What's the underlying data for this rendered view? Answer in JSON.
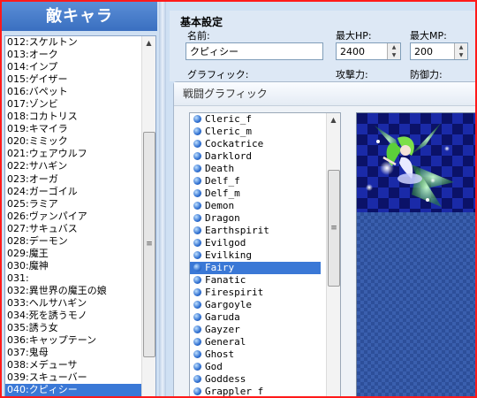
{
  "left_panel": {
    "title": "敵キャラ",
    "items": [
      "012:スケルトン",
      "013:オーク",
      "014:インプ",
      "015:ゲイザー",
      "016:バペット",
      "017:ゾンビ",
      "018:コカトリス",
      "019:キマイラ",
      "020:ミミック",
      "021:ウェアウルフ",
      "022:サハギン",
      "023:オーガ",
      "024:ガーゴイル",
      "025:ラミア",
      "026:ヴァンパイア",
      "027:サキュバス",
      "028:デーモン",
      "029:魔王",
      "030:魔神",
      "031:",
      "032:異世界の魔王の娘",
      "033:ヘルサハギン",
      "034:死を誘うモノ",
      "035:誘う女",
      "036:キャップテーン",
      "037:鬼母",
      "038:メデューサ",
      "039:スキューバー",
      "040:クピィシー"
    ],
    "selected_index": 28
  },
  "basic": {
    "title": "基本設定",
    "name_label": "名前:",
    "name_value": "クピィシー",
    "maxhp_label": "最大HP:",
    "maxhp_value": "2400",
    "maxmp_label": "最大MP:",
    "maxmp_value": "200",
    "graphic_label": "グラフィック:",
    "attack_label": "攻撃力:",
    "defense_label": "防御力:"
  },
  "dialog": {
    "title": "戦闘グラフィック",
    "items": [
      "Cleric_f",
      "Cleric_m",
      "Cockatrice",
      "Darklord",
      "Death",
      "Delf_f",
      "Delf_m",
      "Demon",
      "Dragon",
      "Earthspirit",
      "Evilgod",
      "Evilking",
      "Fairy",
      "Fanatic",
      "Firespirit",
      "Gargoyle",
      "Garuda",
      "Gayzer",
      "General",
      "Ghost",
      "God",
      "Goddess",
      "Grappler_f"
    ],
    "selected_index": 12
  },
  "colors": {
    "selection": "#3a78d6",
    "frame_border": "#ff1a1a",
    "header_blue": "#3a6fc0"
  }
}
